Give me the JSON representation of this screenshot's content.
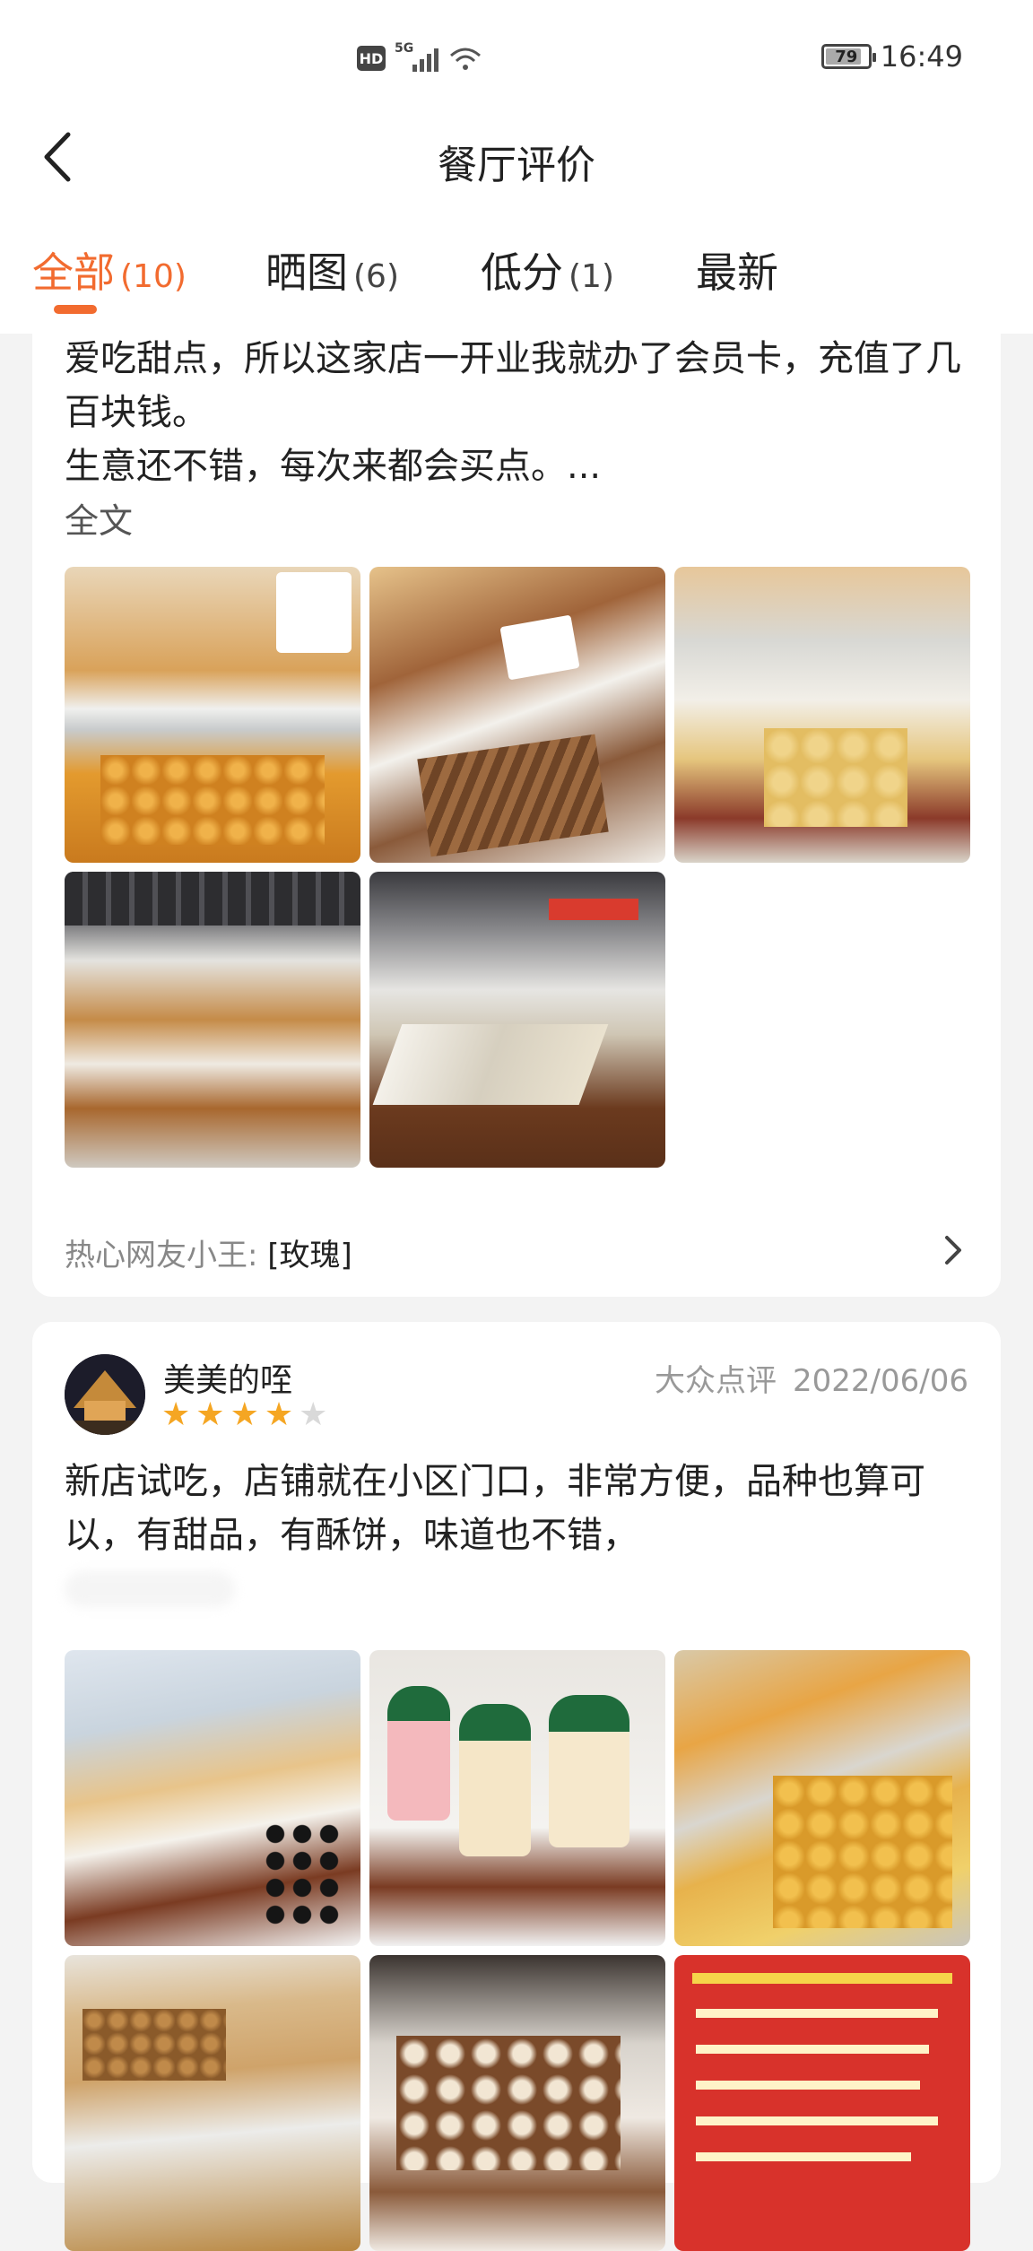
{
  "status_bar": {
    "hd": "HD",
    "network": "5G",
    "battery": "79",
    "battery_level": 0.79,
    "time": "16:49"
  },
  "header": {
    "title": "餐厅评价",
    "back_icon": "chevron-left-icon"
  },
  "tabs": [
    {
      "label": "全部",
      "count": "(10)",
      "active": true
    },
    {
      "label": "晒图",
      "count": "(6)",
      "active": false
    },
    {
      "label": "低分",
      "count": "(1)",
      "active": false
    },
    {
      "label": "最新",
      "count": "",
      "active": false
    }
  ],
  "review1": {
    "text": "爱吃甜点，所以这家店一开业我就办了会员卡，充值了几百块钱。\n生意还不错，每次来都会买点。...",
    "full_text_link": "全文",
    "photo_count": 5,
    "reply_author": "热心网友小王:",
    "reply_text": "[玫瑰]"
  },
  "review2": {
    "username": "美美的咥",
    "rating": 4,
    "max_rating": 5,
    "source": "大众点评",
    "date": "2022/06/06",
    "text": "新店试吃，店铺就在小区门口，非常方便，品种也算可以，有甜品，有酥饼，味道也不错，",
    "photo_count": 6
  },
  "colors": {
    "accent": "#f26b2f",
    "star": "#f5a623",
    "background": "#f3f3f3"
  }
}
